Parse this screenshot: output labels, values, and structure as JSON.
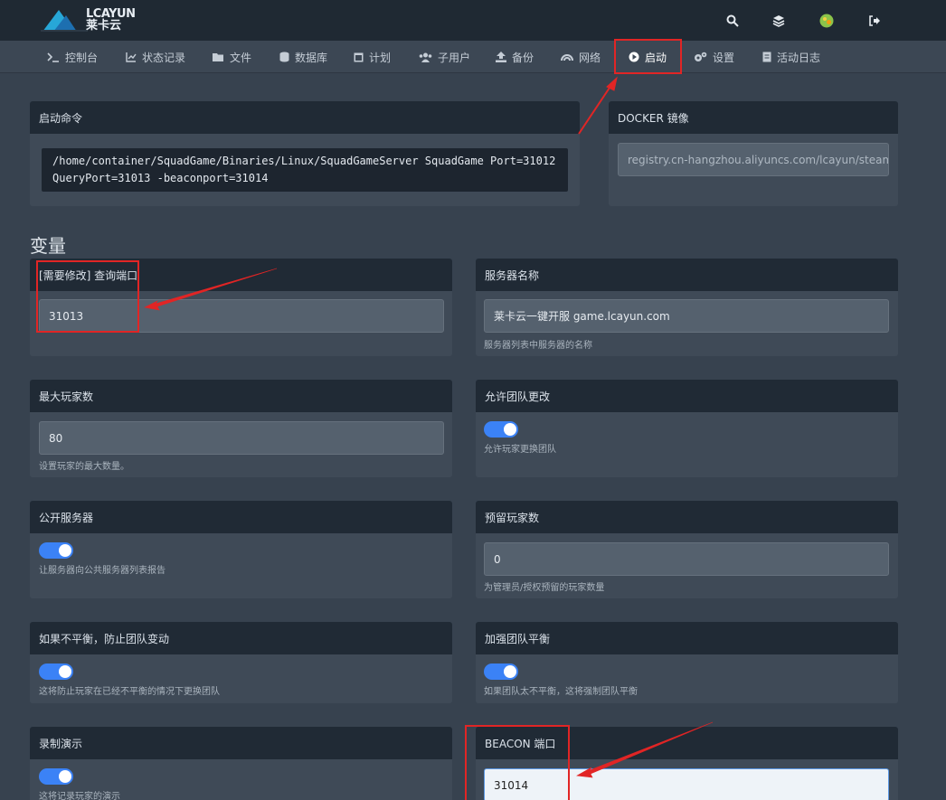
{
  "brand": {
    "logo_text": "LCAYUN",
    "logo_cn": "莱卡云"
  },
  "topbar": {
    "icons": [
      "search-icon",
      "layers-icon",
      "user-avatar-icon",
      "logout-icon"
    ]
  },
  "nav": {
    "items": [
      {
        "label": "控制台",
        "icon": "terminal-icon"
      },
      {
        "label": "状态记录",
        "icon": "chart-icon"
      },
      {
        "label": "文件",
        "icon": "folder-icon"
      },
      {
        "label": "数据库",
        "icon": "database-icon"
      },
      {
        "label": "计划",
        "icon": "calendar-icon"
      },
      {
        "label": "子用户",
        "icon": "users-icon"
      },
      {
        "label": "备份",
        "icon": "upload-icon"
      },
      {
        "label": "网络",
        "icon": "network-icon"
      },
      {
        "label": "启动",
        "icon": "play-icon",
        "active": true
      },
      {
        "label": "设置",
        "icon": "gears-icon"
      },
      {
        "label": "活动日志",
        "icon": "log-icon"
      }
    ]
  },
  "startup": {
    "title": "启动命令",
    "command_line1": "/home/container/SquadGame/Binaries/Linux/SquadGameServer SquadGame Port=31012",
    "command_line2": "QueryPort=31013 -beaconport=31014"
  },
  "docker": {
    "title": "DOCKER 镜像",
    "value": "registry.cn-hangzhou.aliyuncs.com/lcayun/steamcmd"
  },
  "variables_title": "变量",
  "variables": {
    "query_port": {
      "label": "[需要修改] 查询端口",
      "value": "31013"
    },
    "server_name": {
      "label": "服务器名称",
      "value": "莱卡云一键开服 game.lcayun.com",
      "help": "服务器列表中服务器的名称"
    },
    "max_players": {
      "label": "最大玩家数",
      "value": "80",
      "help": "设置玩家的最大数量。"
    },
    "allow_team_change": {
      "label": "允许团队更改",
      "enabled": true,
      "help": "允许玩家更换团队"
    },
    "public_server": {
      "label": "公开服务器",
      "enabled": true,
      "help": "让服务器向公共服务器列表报告"
    },
    "reserved_players": {
      "label": "预留玩家数",
      "value": "0",
      "help": "为管理员/授权预留的玩家数量"
    },
    "prevent_unbalanced": {
      "label": "如果不平衡，防止团队变动",
      "enabled": true,
      "help": "这将防止玩家在已经不平衡的情况下更换团队"
    },
    "force_balance": {
      "label": "加强团队平衡",
      "enabled": true,
      "help": "如果团队太不平衡，这将强制团队平衡"
    },
    "record_demo": {
      "label": "录制演示",
      "enabled": true,
      "help": "这将记录玩家的演示"
    },
    "beacon_port": {
      "label": "BEACON 端口",
      "value": "31014"
    }
  },
  "colors": {
    "annotation": "#e12525",
    "toggle_on": "#3b82f6"
  }
}
